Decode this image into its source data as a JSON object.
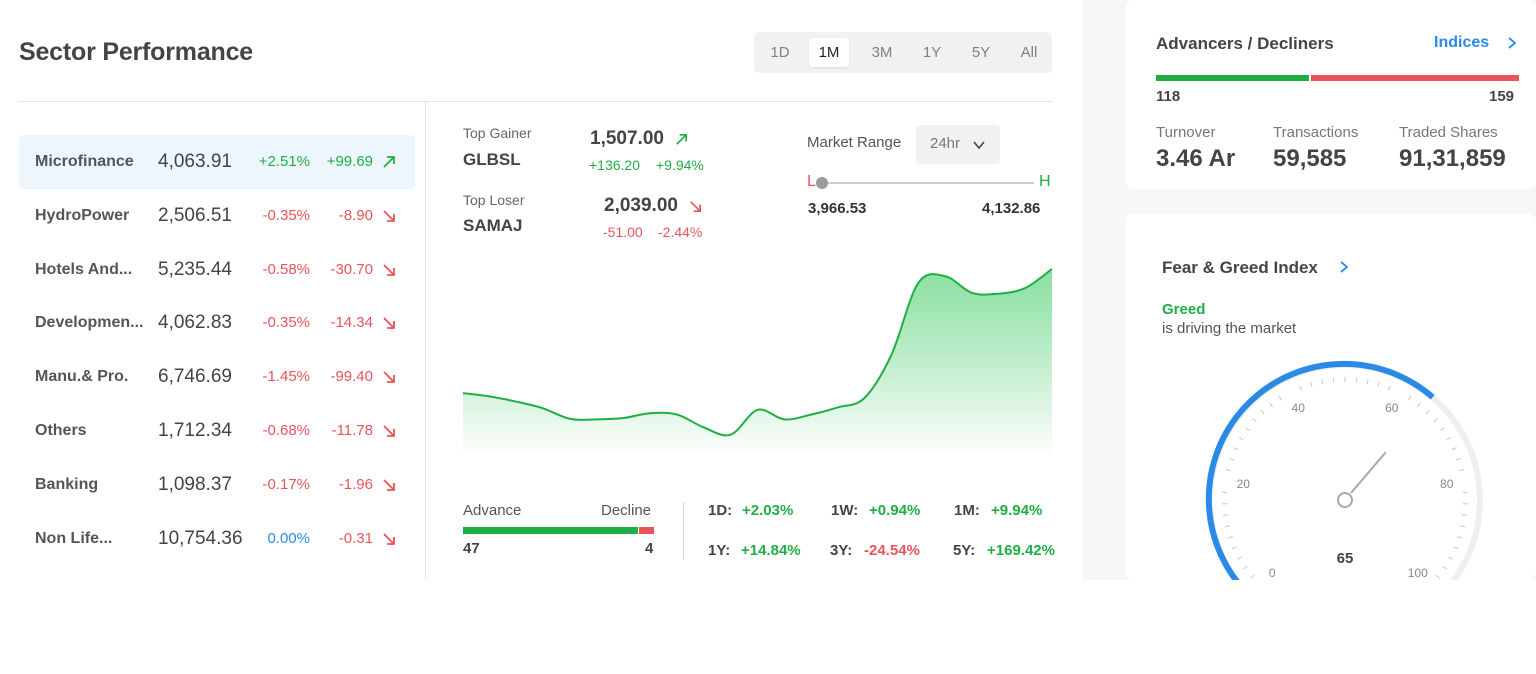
{
  "sector": {
    "title": "Sector Performance",
    "ranges": [
      "1D",
      "1M",
      "3M",
      "1Y",
      "5Y",
      "All"
    ],
    "active_range": "1M",
    "rows": [
      {
        "name": "Microfinance",
        "value": "4,063.91",
        "pct": "+2.51%",
        "change": "+99.69",
        "direction": "up",
        "selected": true
      },
      {
        "name": "HydroPower",
        "value": "2,506.51",
        "pct": "-0.35%",
        "change": "-8.90",
        "direction": "down"
      },
      {
        "name": "Hotels And...",
        "value": "5,235.44",
        "pct": "-0.58%",
        "change": "-30.70",
        "direction": "down"
      },
      {
        "name": "Developmen...",
        "value": "4,062.83",
        "pct": "-0.35%",
        "change": "-14.34",
        "direction": "down"
      },
      {
        "name": "Manu.& Pro.",
        "value": "6,746.69",
        "pct": "-1.45%",
        "change": "-99.40",
        "direction": "down"
      },
      {
        "name": "Others",
        "value": "1,712.34",
        "pct": "-0.68%",
        "change": "-11.78",
        "direction": "down"
      },
      {
        "name": "Banking",
        "value": "1,098.37",
        "pct": "-0.17%",
        "change": "-1.96",
        "direction": "down"
      },
      {
        "name": "Non Life...",
        "value": "10,754.36",
        "pct": "0.00%",
        "change": "-0.31",
        "direction": "down",
        "pct_neutral": true
      }
    ]
  },
  "detail": {
    "top_gainer": {
      "label": "Top Gainer",
      "symbol": "GLBSL",
      "price": "1,507.00",
      "change": "+136.20",
      "pct": "+9.94%"
    },
    "top_loser": {
      "label": "Top Loser",
      "symbol": "SAMAJ",
      "price": "2,039.00",
      "change": "-51.00",
      "pct": "-2.44%"
    },
    "market_range": {
      "label": "Market Range",
      "period": "24hr",
      "low_label": "L",
      "high_label": "H",
      "low": "3,966.53",
      "high": "4,132.86",
      "position_fraction": 0.0
    },
    "advance_decline": {
      "advance_label": "Advance",
      "decline_label": "Decline",
      "advance": 47,
      "decline": 4
    },
    "performance": [
      {
        "label": "1D:",
        "value": "+2.03%",
        "dir": "up"
      },
      {
        "label": "1W:",
        "value": "+0.94%",
        "dir": "up"
      },
      {
        "label": "1M:",
        "value": "+9.94%",
        "dir": "up"
      },
      {
        "label": "1Y:",
        "value": "+14.84%",
        "dir": "up"
      },
      {
        "label": "3Y:",
        "value": "-24.54%",
        "dir": "down"
      },
      {
        "label": "5Y:",
        "value": "+169.42%",
        "dir": "up"
      }
    ]
  },
  "chart_data": {
    "type": "area",
    "series": [
      {
        "values": [
          3700,
          3693,
          3682,
          3668,
          3646,
          3645,
          3648,
          3658,
          3655,
          3628,
          3613,
          3665,
          3645,
          3655,
          3670,
          3690,
          3780,
          3930,
          3945,
          3910,
          3908,
          3920,
          3960
        ]
      }
    ],
    "ylim": [
      3560,
      4010
    ],
    "xlabel": "",
    "ylabel": "",
    "grid": false,
    "colors": {
      "line": "#1fae44",
      "fill_top": "#7ddc96",
      "fill_bottom": "#ffffff"
    }
  },
  "breadth": {
    "title": "Advancers / Decliners",
    "link_label": "Indices",
    "advancers": 118,
    "decliners": 159,
    "stats": [
      {
        "label": "Turnover",
        "value": "3.46 Ar"
      },
      {
        "label": "Transactions",
        "value": "59,585"
      },
      {
        "label": "Traded Shares",
        "value": "91,31,859"
      }
    ]
  },
  "fear_greed": {
    "title": "Fear & Greed Index",
    "state": "Greed",
    "description": "is driving the market",
    "value": 65,
    "value_label": "65",
    "ticks": [
      "0",
      "20",
      "40",
      "60",
      "80",
      "100"
    ],
    "colors": {
      "arc": "#2b8ae6",
      "track": "#eeeeee"
    }
  },
  "colors": {
    "up": "#1fae44",
    "down": "#e8545a",
    "neutral": "#2b8ae6",
    "accent": "#2b8ae6"
  }
}
